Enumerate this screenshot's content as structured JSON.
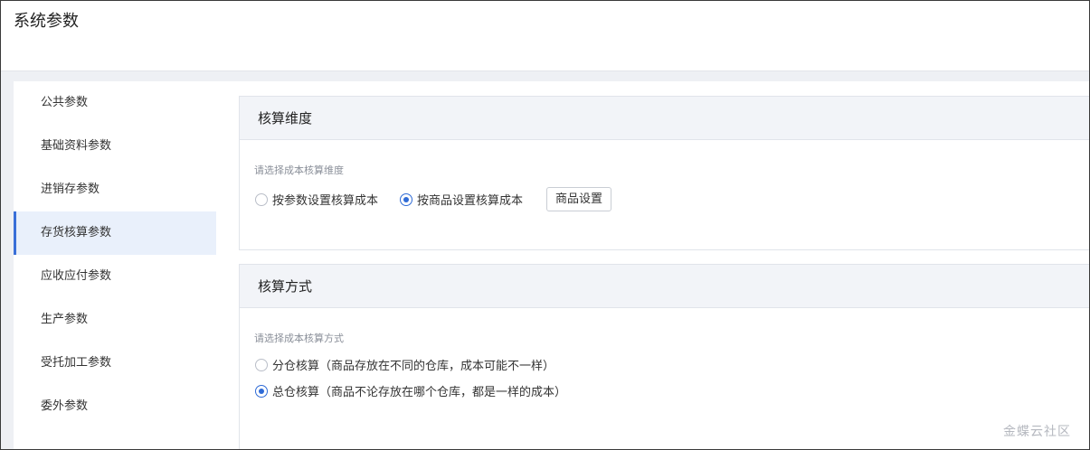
{
  "page": {
    "title": "系统参数"
  },
  "sidebar": {
    "items": [
      {
        "label": "公共参数",
        "active": false
      },
      {
        "label": "基础资料参数",
        "active": false
      },
      {
        "label": "进销存参数",
        "active": false
      },
      {
        "label": "存货核算参数",
        "active": true
      },
      {
        "label": "应收应付参数",
        "active": false
      },
      {
        "label": "生产参数",
        "active": false
      },
      {
        "label": "受托加工参数",
        "active": false
      },
      {
        "label": "委外参数",
        "active": false
      }
    ]
  },
  "dimension_section": {
    "title": "核算维度",
    "hint": "请选择成本核算维度",
    "options": [
      {
        "label": "按参数设置核算成本",
        "selected": false
      },
      {
        "label": "按商品设置核算成本",
        "selected": true
      }
    ],
    "settings_button": "商品设置"
  },
  "method_section": {
    "title": "核算方式",
    "hint": "请选择成本核算方式",
    "options": [
      {
        "label": "分仓核算（商品存放在不同的仓库，成本可能不一样）",
        "selected": false
      },
      {
        "label": "总仓核算（商品不论存放在哪个仓库，都是一样的成本）",
        "selected": true
      }
    ]
  },
  "watermark": "金蝶云社区",
  "colors": {
    "accent": "#2f6bd6",
    "active_bg": "#e9f0fb",
    "header_bg": "#f2f4f8"
  }
}
